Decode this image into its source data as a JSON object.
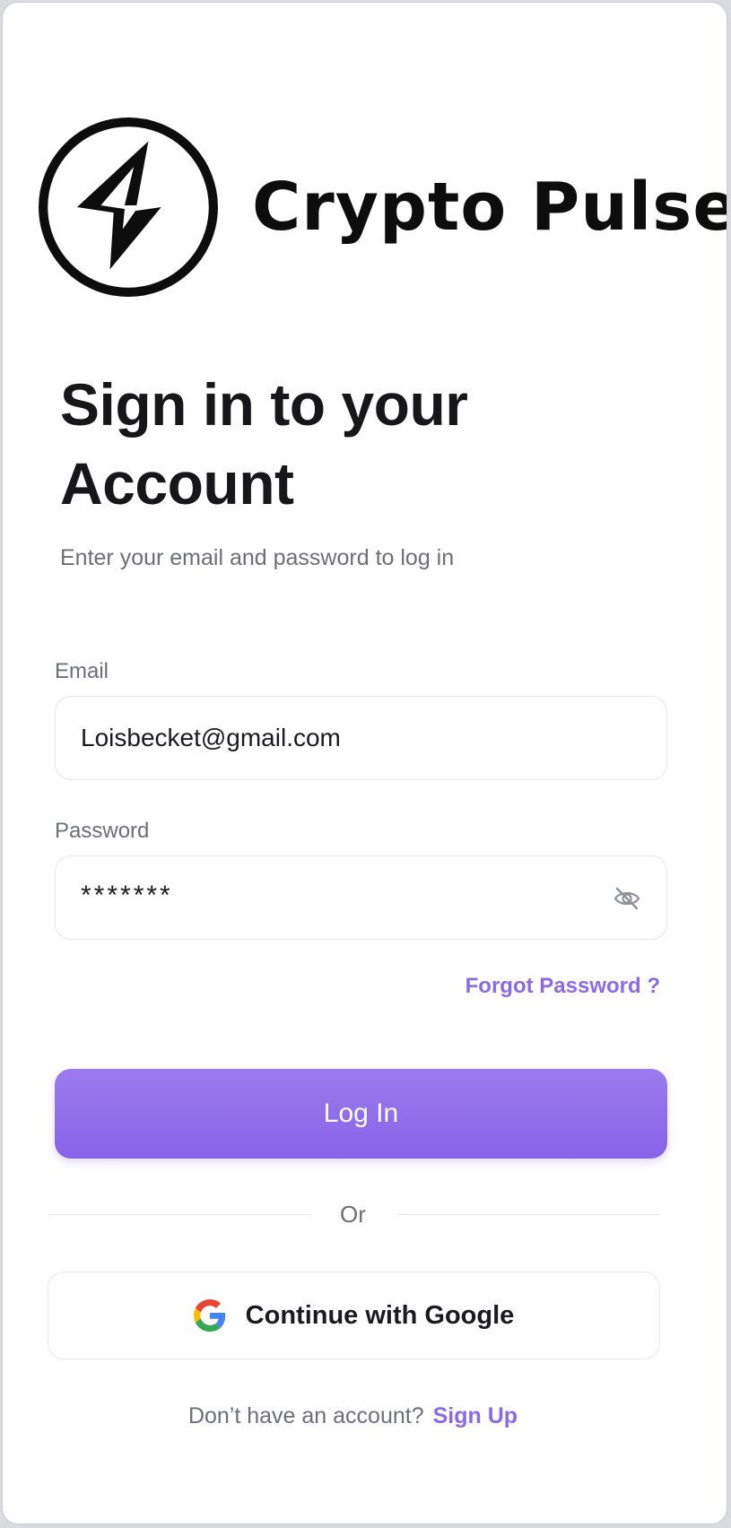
{
  "brand": {
    "name": "Crypto Pulse",
    "logo_icon": "lightning-bolt-logo-icon"
  },
  "heading": {
    "title": "Sign in to your Account",
    "subtitle": "Enter your email and password to log in"
  },
  "form": {
    "email_label": "Email",
    "email_value": "Loisbecket@gmail.com",
    "password_label": "Password",
    "password_value": "*******",
    "password_toggle_icon": "eye-off-icon",
    "forgot_link": "Forgot Password ?",
    "login_button": "Log In"
  },
  "alt_login": {
    "divider_text": "Or",
    "google_button": "Continue with Google",
    "google_icon": "google-icon"
  },
  "footer": {
    "prompt": "Don’t have an account?",
    "signup_link": "Sign Up"
  },
  "colors": {
    "accent": "#8B6AE6",
    "button_gradient_top": "#9B7BEE",
    "button_gradient_bottom": "#8663E8",
    "text_primary": "#17171A",
    "text_secondary": "#6D6F76"
  }
}
